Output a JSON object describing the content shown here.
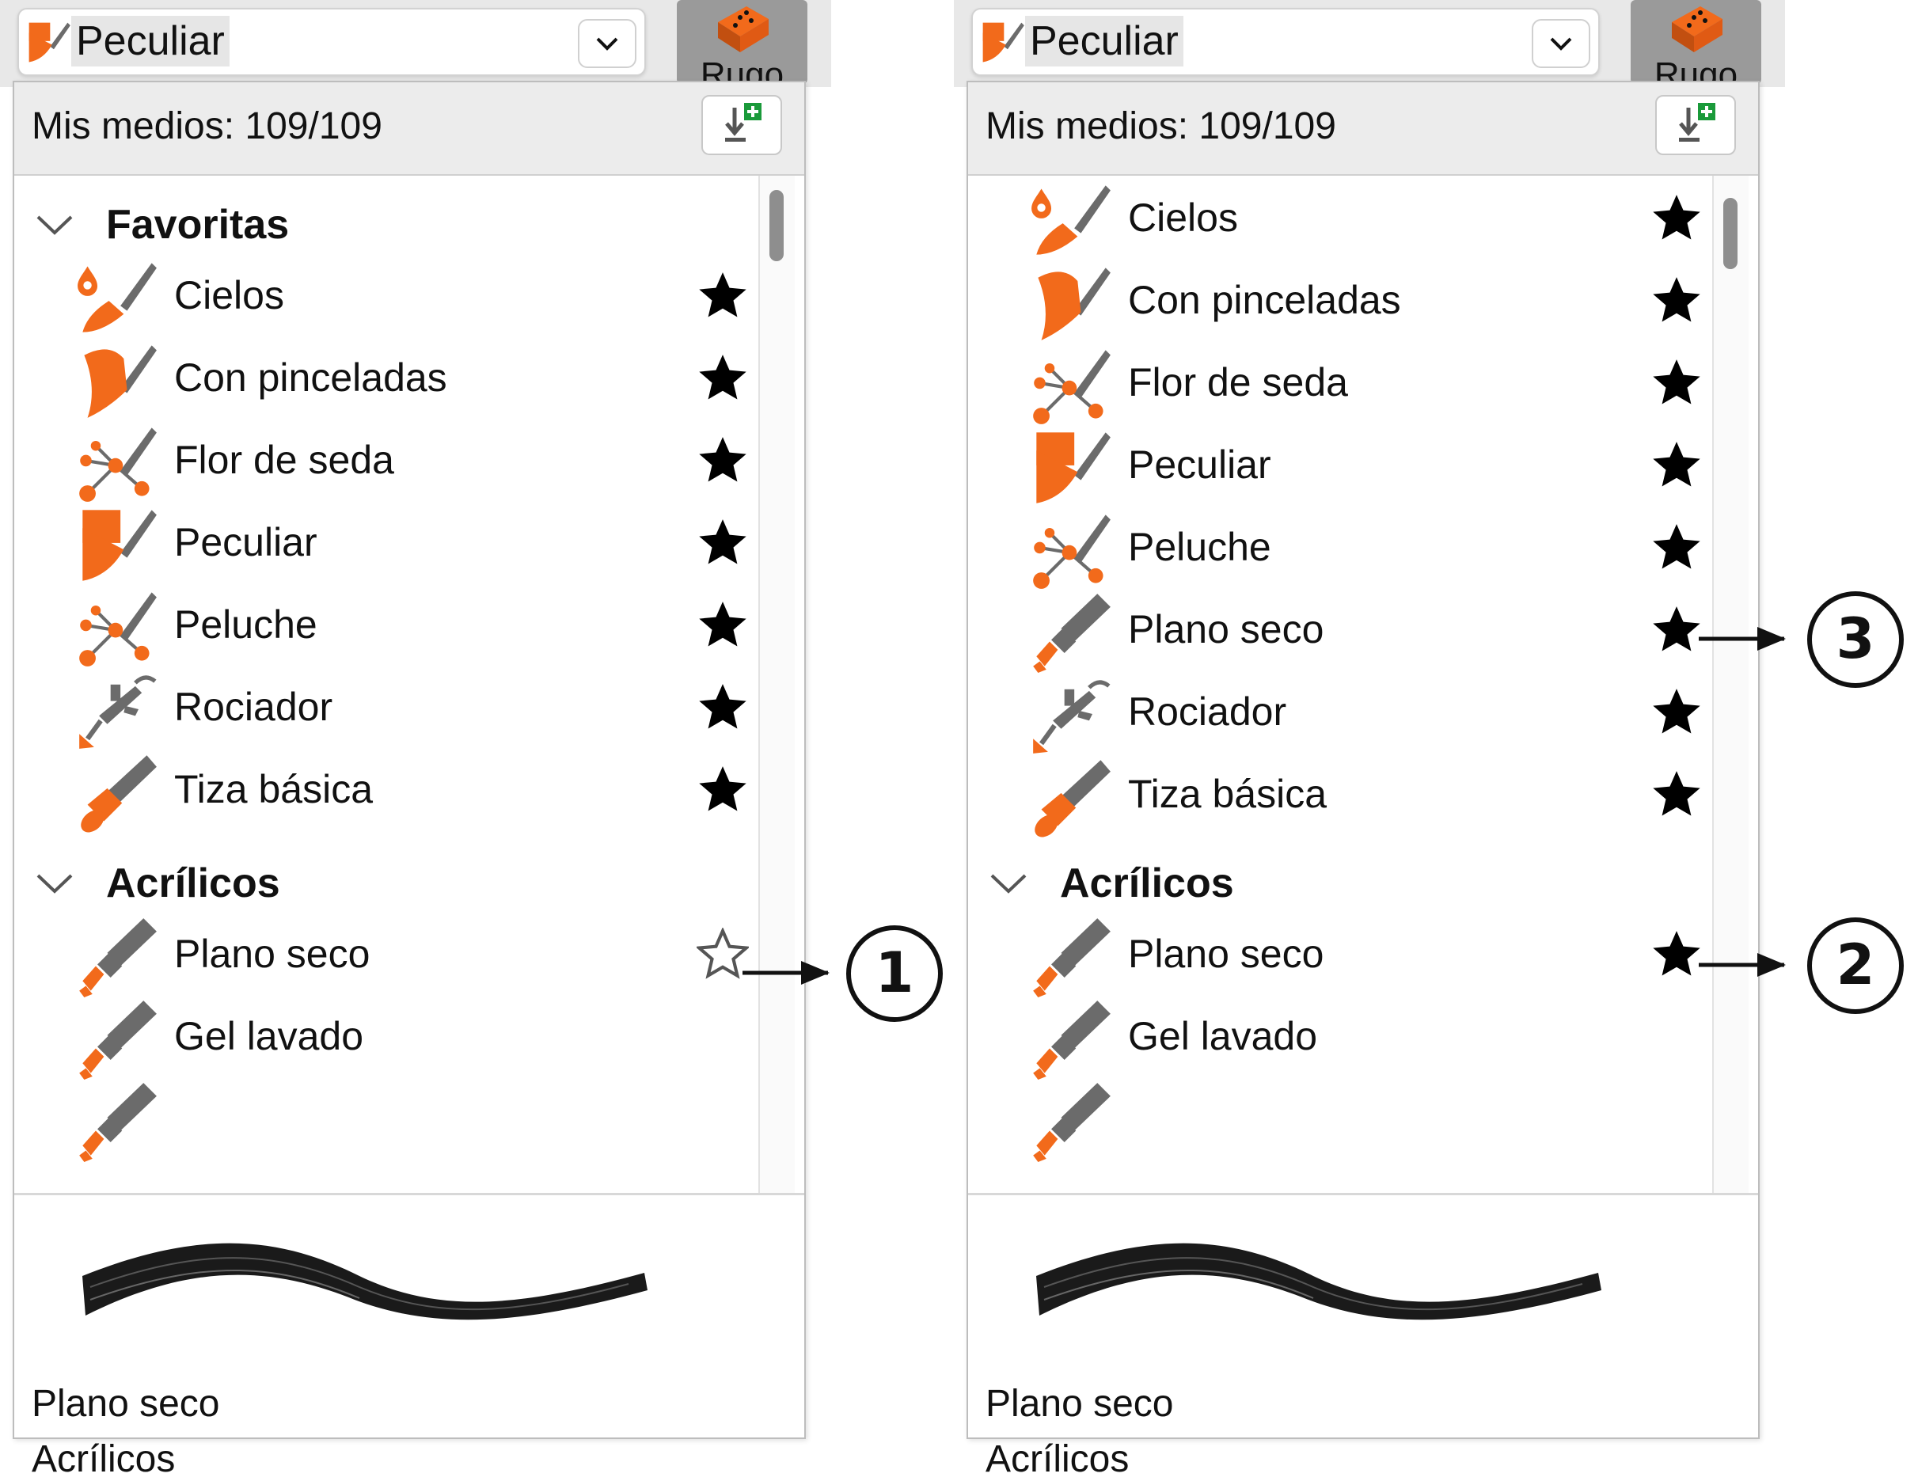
{
  "selector": {
    "label": "Peculiar",
    "icon": "peculiar-brush-icon"
  },
  "variant_button": {
    "label": "Rugo",
    "icon": "sponge-icon"
  },
  "panel": {
    "media_count": "Mis medios: 109/109",
    "import_icon": "import-media-icon"
  },
  "left_panel": {
    "favorites_group": {
      "title": "Favoritas",
      "items": [
        {
          "name": "Cielos",
          "icon": "sky-brush-icon",
          "favorite": true
        },
        {
          "name": "Con pinceladas",
          "icon": "stroke-brush-icon",
          "favorite": true
        },
        {
          "name": "Flor de seda",
          "icon": "silk-flower-brush-icon",
          "favorite": true
        },
        {
          "name": "Peculiar",
          "icon": "peculiar-brush-icon",
          "favorite": true
        },
        {
          "name": "Peluche",
          "icon": "plush-brush-icon",
          "favorite": true
        },
        {
          "name": "Rociador",
          "icon": "airbrush-icon",
          "favorite": true
        },
        {
          "name": "Tiza básica",
          "icon": "chalk-icon",
          "favorite": true
        }
      ]
    },
    "acrylics_group": {
      "title": "Acrílicos",
      "items": [
        {
          "name": "Plano seco",
          "icon": "flat-brush-icon",
          "favorite": false
        },
        {
          "name": "Gel lavado",
          "icon": "flat-brush-icon",
          "favorite": false
        }
      ]
    },
    "preview": {
      "brush_name": "Plano seco",
      "category": "Acrílicos"
    },
    "callout": "1"
  },
  "right_panel": {
    "favorites_items": [
      {
        "name": "Cielos",
        "icon": "sky-brush-icon",
        "favorite": true
      },
      {
        "name": "Con pinceladas",
        "icon": "stroke-brush-icon",
        "favorite": true
      },
      {
        "name": "Flor de seda",
        "icon": "silk-flower-brush-icon",
        "favorite": true
      },
      {
        "name": "Peculiar",
        "icon": "peculiar-brush-icon",
        "favorite": true
      },
      {
        "name": "Peluche",
        "icon": "plush-brush-icon",
        "favorite": true
      },
      {
        "name": "Plano seco",
        "icon": "flat-brush-icon",
        "favorite": true
      },
      {
        "name": "Rociador",
        "icon": "airbrush-icon",
        "favorite": true
      },
      {
        "name": "Tiza básica",
        "icon": "chalk-icon",
        "favorite": true
      }
    ],
    "acrylics_group": {
      "title": "Acrílicos",
      "items": [
        {
          "name": "Plano seco",
          "icon": "flat-brush-icon",
          "favorite": true
        },
        {
          "name": "Gel lavado",
          "icon": "flat-brush-icon",
          "favorite": false
        }
      ]
    },
    "preview": {
      "brush_name": "Plano seco",
      "category": "Acrílicos"
    },
    "callouts": [
      "2",
      "3"
    ]
  },
  "colors": {
    "accent": "#f26a1b",
    "brush_gray": "#6b6b6b",
    "import_green": "#1a9a3a"
  }
}
